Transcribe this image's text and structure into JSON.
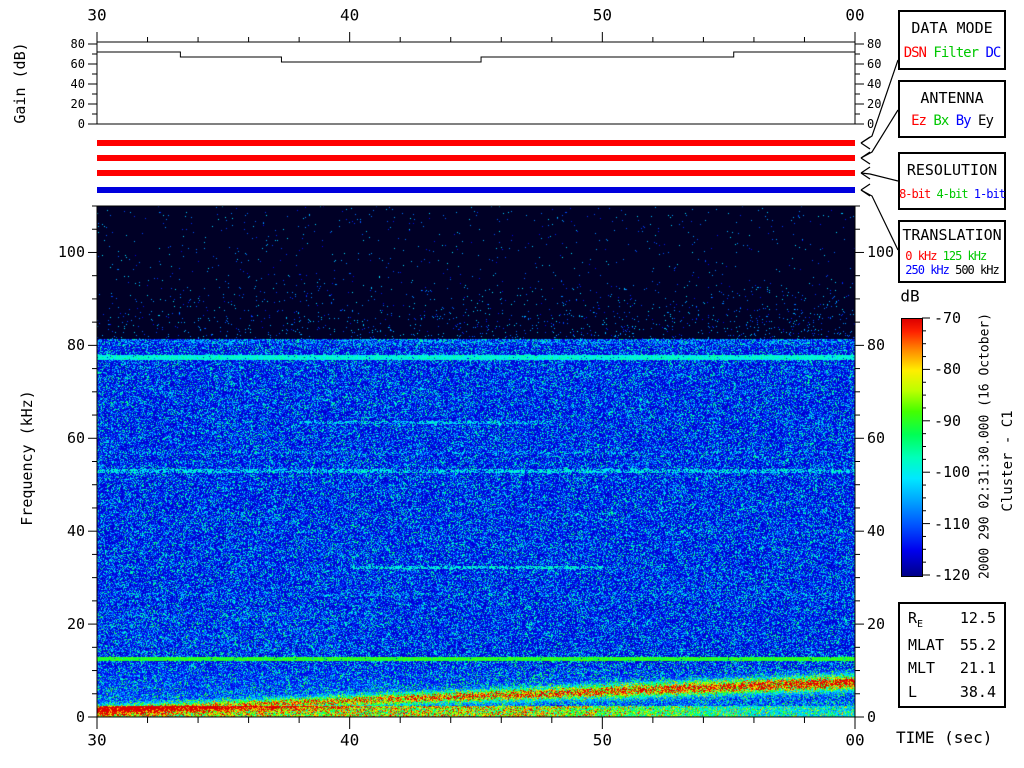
{
  "titles": {
    "gain_axis": "Gain (dB)",
    "freq_axis": "Frequency (kHz)",
    "time_axis": "TIME (sec)",
    "colorbar": "dB",
    "timestamp": "2000 290 02:31:30.000 (16 October)",
    "spacecraft": "Cluster - C1"
  },
  "legend_boxes": [
    {
      "id": "data-mode",
      "title": "DATA MODE",
      "rows": [
        [
          {
            "label": "DSN",
            "color": "#ff0000"
          },
          {
            "label": "Filter",
            "color": "#00c800"
          },
          {
            "label": "DC",
            "color": "#0000ff"
          }
        ]
      ]
    },
    {
      "id": "antenna",
      "title": "ANTENNA",
      "rows": [
        [
          {
            "label": "Ez",
            "color": "#ff0000"
          },
          {
            "label": "Bx",
            "color": "#00c800"
          },
          {
            "label": "By",
            "color": "#0000ff"
          },
          {
            "label": "Ey",
            "color": "#000000"
          }
        ]
      ]
    },
    {
      "id": "resolution",
      "title": "RESOLUTION",
      "rows": [
        [
          {
            "label": "8-bit",
            "color": "#ff0000"
          },
          {
            "label": "4-bit",
            "color": "#00c800"
          },
          {
            "label": "1-bit",
            "color": "#0000ff"
          }
        ]
      ]
    },
    {
      "id": "translation",
      "title": "TRANSLATION",
      "rows": [
        [
          {
            "label": "0 kHz",
            "color": "#ff0000"
          },
          {
            "label": "125 kHz",
            "color": "#00c800"
          }
        ],
        [
          {
            "label": "250 kHz",
            "color": "#0000ff"
          },
          {
            "label": "500 kHz",
            "color": "#000000"
          }
        ]
      ]
    }
  ],
  "status_bars": [
    {
      "name": "data-mode-bar",
      "selected": "DSN",
      "color": "#ff0000"
    },
    {
      "name": "antenna-bar",
      "selected": "Ez",
      "color": "#ff0000"
    },
    {
      "name": "resolution-bar",
      "selected": "8-bit",
      "color": "#ff0000"
    },
    {
      "name": "translation-bar",
      "selected": "250 kHz",
      "color": "#0000dd"
    }
  ],
  "info_panel": {
    "rows": [
      {
        "label": "R",
        "sub": "E",
        "value": "12.5"
      },
      {
        "label": "MLAT",
        "value": "55.2"
      },
      {
        "label": "MLT",
        "value": "21.1"
      },
      {
        "label": "L",
        "value": "38.4"
      }
    ]
  },
  "chart_data": [
    {
      "id": "gain-panel",
      "type": "line",
      "ylabel": "Gain (dB)",
      "ylim": [
        0,
        80
      ],
      "yticks": [
        0,
        20,
        40,
        60,
        80
      ],
      "xlim": [
        30,
        60
      ],
      "xticks": [
        30,
        40,
        50,
        60
      ],
      "xtick_labels": [
        "30",
        "40",
        "50",
        "00"
      ],
      "series": [
        {
          "name": "gain",
          "points": [
            [
              30,
              72
            ],
            [
              33.3,
              72
            ],
            [
              33.3,
              67
            ],
            [
              37.3,
              67
            ],
            [
              37.3,
              62
            ],
            [
              45.2,
              62
            ],
            [
              45.2,
              67
            ],
            [
              55.2,
              67
            ],
            [
              55.2,
              72
            ],
            [
              60,
              72
            ]
          ]
        }
      ]
    },
    {
      "id": "spectrogram",
      "type": "heatmap",
      "xlabel": "TIME (sec)",
      "ylabel": "Frequency (kHz)",
      "xlim": [
        30,
        60
      ],
      "xticks": [
        30,
        40,
        50,
        60
      ],
      "xtick_labels": [
        "30",
        "40",
        "50",
        "00"
      ],
      "ylim": [
        0,
        110
      ],
      "yticks": [
        0,
        20,
        40,
        60,
        80,
        100
      ],
      "colorbar": {
        "label": "dB",
        "min": -120,
        "max": -70,
        "ticks": [
          -70,
          -80,
          -90,
          -100,
          -110,
          -120
        ]
      },
      "colormap": [
        [
          0.0,
          "#000088"
        ],
        [
          0.1,
          "#0000ee"
        ],
        [
          0.2,
          "#0055ff"
        ],
        [
          0.3,
          "#00aaff"
        ],
        [
          0.38,
          "#00e8ff"
        ],
        [
          0.46,
          "#00ffbb"
        ],
        [
          0.55,
          "#00ff55"
        ],
        [
          0.64,
          "#44ff00"
        ],
        [
          0.72,
          "#bbff00"
        ],
        [
          0.8,
          "#ffee00"
        ],
        [
          0.88,
          "#ff8800"
        ],
        [
          0.95,
          "#ff2200"
        ],
        [
          1.0,
          "#dd0000"
        ]
      ],
      "features": {
        "background_color": "#000026",
        "noise_ceiling_khz": 81.5,
        "horizontal_lines": [
          {
            "f": 81.0,
            "w": 0.8,
            "p": 0.3,
            "i": 0.3,
            "t0": 30,
            "t1": 60
          },
          {
            "f": 77.5,
            "w": 0.7,
            "p": 0.97,
            "i": 0.42,
            "t0": 30,
            "t1": 60
          },
          {
            "f": 63.5,
            "w": 0.55,
            "p": 0.5,
            "i": 0.38,
            "t0": 38,
            "t1": 48
          },
          {
            "f": 57.0,
            "w": 0.5,
            "p": 0.2,
            "i": 0.32,
            "t0": 30,
            "t1": 60
          },
          {
            "f": 53.0,
            "w": 0.6,
            "p": 0.55,
            "i": 0.4,
            "t0": 30,
            "t1": 60
          },
          {
            "f": 32.3,
            "w": 0.55,
            "p": 0.6,
            "i": 0.42,
            "t0": 40,
            "t1": 50
          },
          {
            "f": 26.5,
            "w": 0.5,
            "p": 0.18,
            "i": 0.3,
            "t0": 30,
            "t1": 60
          },
          {
            "f": 12.5,
            "w": 0.6,
            "p": 0.98,
            "i": 0.6,
            "t0": 30,
            "t1": 60
          }
        ],
        "rising_band": {
          "f0_khz": 1.6,
          "slope_khz_per_s": 0.2,
          "sigma0": 0.9,
          "sigma_grow": 0.02,
          "amp0": 0.62,
          "amp1": 0.95,
          "note": "intense hiss band rising from ~1.5 kHz at 30 s to ~8 kHz at 60 s, green-yellow-orange"
        },
        "bottom_strip": {
          "fmax_khz": 2.4,
          "amp": 0.5,
          "fade_after_s": 47
        }
      }
    }
  ]
}
